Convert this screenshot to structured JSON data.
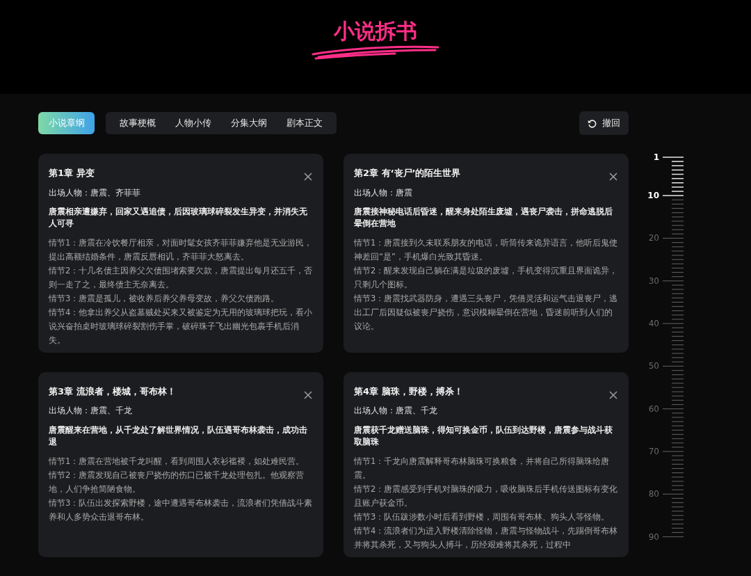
{
  "title": "小说拆书",
  "tabs": [
    {
      "label": "小说章纲",
      "selected": true
    },
    {
      "label": "故事梗概",
      "selected": false
    },
    {
      "label": "人物小传",
      "selected": false
    },
    {
      "label": "分集大纲",
      "selected": false
    },
    {
      "label": "剧本正文",
      "selected": false
    }
  ],
  "undo_button": {
    "label": "撤回"
  },
  "chapters": [
    {
      "title": "第1章 异变",
      "characters": "出场人物：唐震、齐菲菲",
      "summary": "唐震相亲遭嫌弃，回家又遇追债，后因玻璃球碎裂发生异变，并消失无人可寻",
      "plots": [
        "情节1：唐震在冷饮餐厅相亲，对面时髦女孩齐菲菲嫌弃他是无业游民，提出高额结婚条件，唐震反唇相讥，齐菲菲大怒离去。",
        "情节2：十几名债主因养父欠债围堵索要欠款，唐震提出每月还五千，否则一走了之，最终债主无奈离去。",
        "情节3：唐震是孤儿，被收养后养父养母变故，养父欠债跑路。",
        "情节4：他拿出养父从盗墓贼处买来又被鉴定为无用的玻璃球把玩，看小说兴奋拍桌时玻璃球碎裂割伤手掌，破碎珠子飞出幽光包裹手机后消失。"
      ]
    },
    {
      "title": "第2章 有‘丧尸’的陌生世界",
      "characters": "出场人物：唐震",
      "summary": "唐震接神秘电话后昏迷，醒来身处陌生废墟，遇丧尸袭击，拼命逃脱后晕倒在营地",
      "plots": [
        "情节1：唐震接到久未联系朋友的电话，听筒传来诡异语言，他听后鬼使神差回“是”，手机爆白光致其昏迷。",
        "情节2：醒来发现自己躺在满是垃圾的废墟，手机变得沉重且界面诡异，只剩几个图标。",
        "情节3：唐震找武器防身，遭遇三头丧尸，凭借灵活和运气击退丧尸，逃出工厂后因疑似被丧尸挠伤，意识模糊晕倒在营地，昏迷前听到人们的议论。"
      ]
    },
    {
      "title": "第3章 流浪者，楼城，哥布林！",
      "characters": "出场人物：唐震、千龙",
      "summary": "唐震醒来在营地，从千龙处了解世界情况，队伍遇哥布林袭击，成功击退",
      "plots": [
        "情节1：唐震在营地被千龙叫醒，看到周围人衣衫褴褛，如处难民营。",
        "情节2：唐震发现自己被丧尸挠伤的伤口已被千龙处理包扎。他观察营地，人们争抢简陋食物。",
        "情节3：队伍出发探索野楼，途中遭遇哥布林袭击，流浪者们凭借战斗素养和人多势众击退哥布林。"
      ]
    },
    {
      "title": "第4章 脑珠，野楼，搏杀！",
      "characters": "出场人物：唐震、千龙",
      "summary": "唐震获千龙赠送脑珠，得知可换金币，队伍到达野楼，唐震参与战斗获取脑珠",
      "plots": [
        "情节1：千龙向唐震解释哥布林脑珠可换粮食，并将自己所得脑珠给唐震。",
        "情节2：唐震感受到手机对脑珠的吸力，吸收脑珠后手机传送图标有变化且账户获金币。",
        "情节3：队伍跋涉数小时后看到野楼，周围有哥布林、狗头人等怪物。",
        "情节4：流浪者们为进入野楼清除怪物，唐震与怪物战斗，先踢倒哥布林并将其杀死，又与狗头人搏斗，历经艰难将其杀死，过程中"
      ]
    }
  ],
  "ruler": {
    "labels": [
      {
        "label": "1",
        "highlighted": true
      },
      {
        "label": "10",
        "highlighted": true
      },
      {
        "label": "20",
        "highlighted": false
      },
      {
        "label": "30",
        "highlighted": false
      },
      {
        "label": "40",
        "highlighted": false
      },
      {
        "label": "50",
        "highlighted": false
      },
      {
        "label": "60",
        "highlighted": false
      },
      {
        "label": "70",
        "highlighted": false
      },
      {
        "label": "80",
        "highlighted": false
      },
      {
        "label": "90",
        "highlighted": false
      }
    ]
  }
}
